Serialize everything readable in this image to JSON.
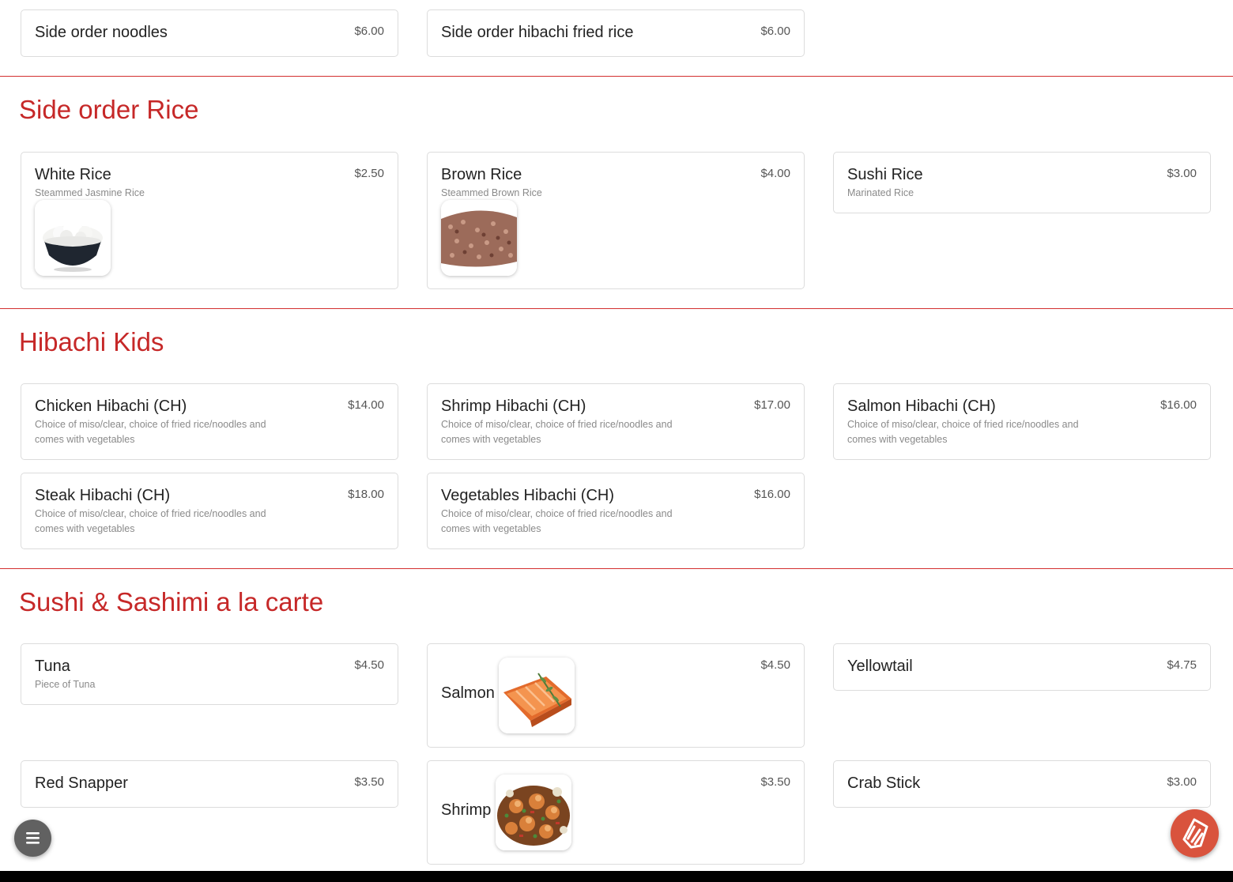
{
  "top_items": [
    {
      "name": "Side order noodles",
      "price": "$6.00"
    },
    {
      "name": "Side order hibachi fried rice",
      "price": "$6.00"
    }
  ],
  "sections": [
    {
      "title": "Side order Rice",
      "items": [
        {
          "name": "White Rice",
          "desc": "Steammed Jasmine Rice",
          "price": "$2.50",
          "image": "white-rice-bowl"
        },
        {
          "name": "Brown Rice",
          "desc": "Steammed Brown Rice",
          "price": "$4.00",
          "image": "brown-rice"
        },
        {
          "name": "Sushi Rice",
          "desc": "Marinated Rice",
          "price": "$3.00"
        }
      ]
    },
    {
      "title": "Hibachi Kids",
      "items": [
        {
          "name": "Chicken Hibachi (CH)",
          "desc": "Choice of miso/clear, choice of fried rice/noodles and comes with vegetables",
          "price": "$14.00"
        },
        {
          "name": "Shrimp Hibachi (CH)",
          "desc": "Choice of miso/clear, choice of fried rice/noodles and comes with vegetables",
          "price": "$17.00"
        },
        {
          "name": "Salmon Hibachi (CH)",
          "desc": "Choice of miso/clear, choice of fried rice/noodles and comes with vegetables",
          "price": "$16.00"
        },
        {
          "name": "Steak Hibachi (CH)",
          "desc": "Choice of miso/clear, choice of fried rice/noodles and comes with vegetables",
          "price": "$18.00"
        },
        {
          "name": "Vegetables Hibachi (CH)",
          "desc": "Choice of miso/clear, choice of fried rice/noodles and comes with vegetables",
          "price": "$16.00"
        }
      ]
    },
    {
      "title": "Sushi & Sashimi a la carte",
      "items": [
        {
          "name": "Tuna",
          "desc": "Piece of Tuna",
          "price": "$4.50"
        },
        {
          "name": "Salmon",
          "price": "$4.50",
          "image": "salmon-fillet"
        },
        {
          "name": "Yellowtail",
          "price": "$4.75"
        },
        {
          "name": "Red Snapper",
          "price": "$3.50"
        },
        {
          "name": "Shrimp",
          "price": "$3.50",
          "image": "shrimp-dish"
        },
        {
          "name": "Crab Stick",
          "price": "$3.00"
        }
      ]
    }
  ],
  "fabs": {
    "menu": {
      "icon": "hamburger-menu-icon",
      "color": "#616161"
    },
    "order": {
      "icon": "order-tag-icon",
      "color": "#d9533d"
    }
  },
  "colors": {
    "accent": "#c62828",
    "divider": "#d32f2f"
  }
}
